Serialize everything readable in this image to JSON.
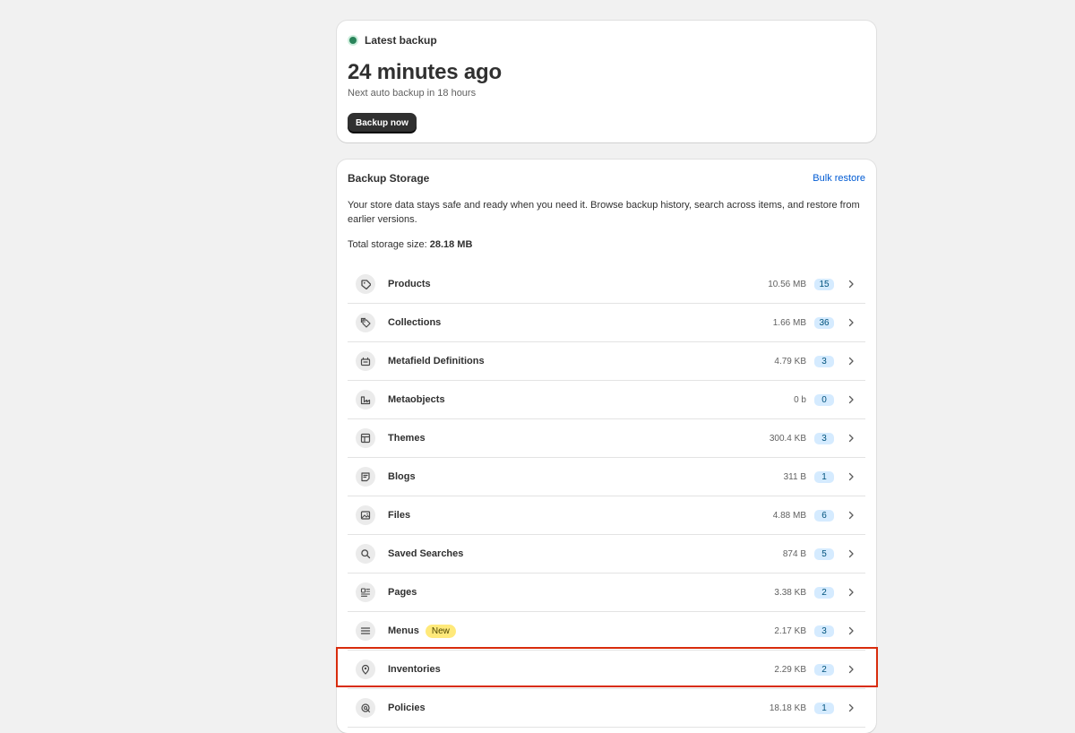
{
  "latest": {
    "status_label": "Latest backup",
    "time_ago": "24 minutes ago",
    "next_auto": "Next auto backup in 18 hours",
    "backup_button": "Backup now"
  },
  "storage": {
    "title": "Backup Storage",
    "bulk_restore": "Bulk restore",
    "description": "Your store data stays safe and ready when you need it. Browse backup history, search across items, and restore from earlier versions.",
    "total_label": "Total storage size:",
    "total_value": "28.18 MB",
    "items": [
      {
        "label": "Products",
        "size": "10.56 MB",
        "count": "15",
        "icon": "tag-icon"
      },
      {
        "label": "Collections",
        "size": "1.66 MB",
        "count": "36",
        "icon": "tags-icon"
      },
      {
        "label": "Metafield Definitions",
        "size": "4.79 KB",
        "count": "3",
        "icon": "metafield-icon"
      },
      {
        "label": "Metaobjects",
        "size": "0 b",
        "count": "0",
        "icon": "metaobject-icon"
      },
      {
        "label": "Themes",
        "size": "300.4 KB",
        "count": "3",
        "icon": "layout-icon"
      },
      {
        "label": "Blogs",
        "size": "311 B",
        "count": "1",
        "icon": "blog-icon"
      },
      {
        "label": "Files",
        "size": "4.88 MB",
        "count": "6",
        "icon": "image-icon"
      },
      {
        "label": "Saved Searches",
        "size": "874 B",
        "count": "5",
        "icon": "search-icon"
      },
      {
        "label": "Pages",
        "size": "3.38 KB",
        "count": "2",
        "icon": "page-icon"
      },
      {
        "label": "Menus",
        "size": "2.17 KB",
        "count": "3",
        "icon": "menu-icon",
        "badge": "New"
      },
      {
        "label": "Inventories",
        "size": "2.29 KB",
        "count": "2",
        "icon": "location-icon"
      },
      {
        "label": "Policies",
        "size": "18.18 KB",
        "count": "1",
        "icon": "policy-icon"
      }
    ]
  },
  "colors": {
    "status_dot": "#29845a",
    "count_badge_bg": "#d5ebff",
    "new_badge_bg": "#ffe97a",
    "link": "#005bd3",
    "highlight": "#d82c0d"
  }
}
